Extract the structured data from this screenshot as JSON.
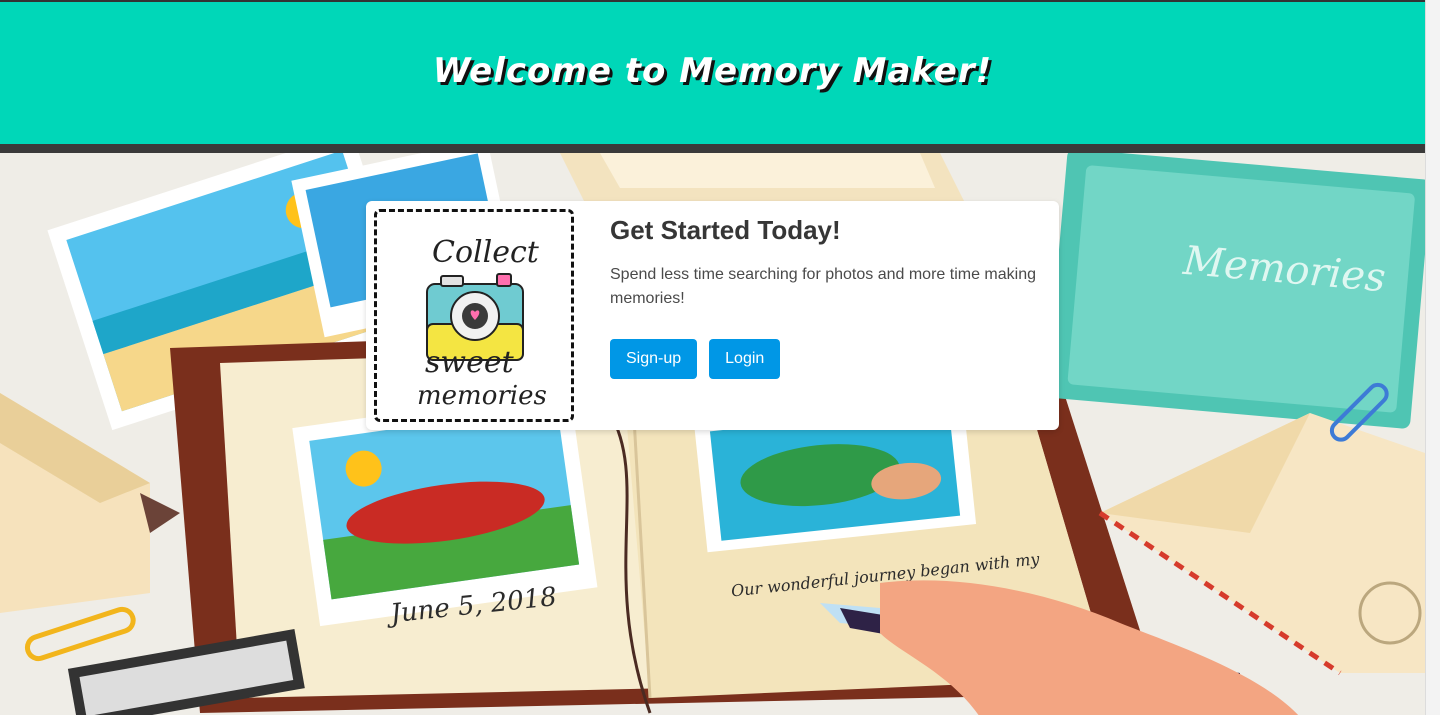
{
  "header": {
    "title": "Welcome to Memory Maker!"
  },
  "card": {
    "image": {
      "text_line1": "Collect",
      "text_line2": "sweet",
      "text_line3": "memories"
    },
    "title": "Get Started Today!",
    "description": "Spend less time searching for photos and more time making memories!",
    "signup_label": "Sign-up",
    "login_label": "Login"
  },
  "background": {
    "notebook_left_caption": "June 5, 2018",
    "notebook_right_caption": "Our wonderful journey began with my",
    "book_cover_title": "Memories"
  },
  "colors": {
    "header": "#00d7b8",
    "header_bar": "#3a3a3a",
    "button": "#0097e6",
    "card": "#ffffff"
  }
}
